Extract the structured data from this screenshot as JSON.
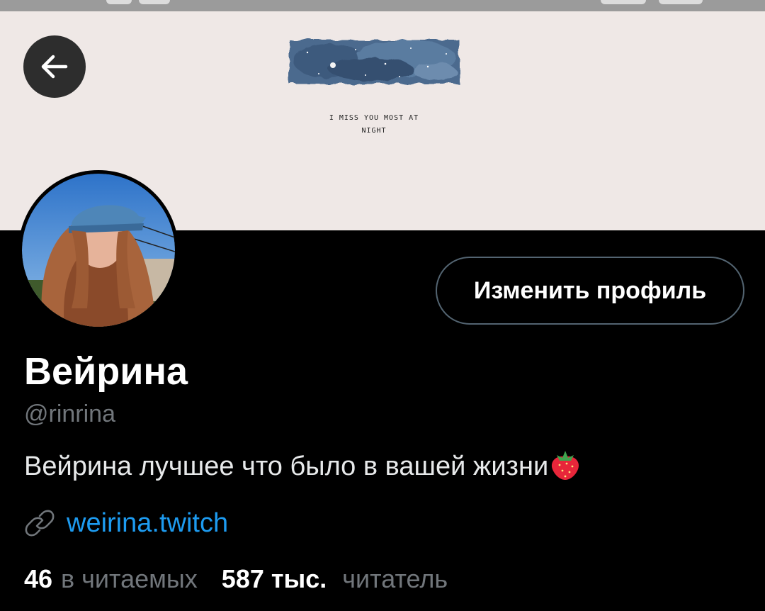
{
  "banner": {
    "caption_line1": "I MISS YOU MOST AT",
    "caption_line2": "NIGHT"
  },
  "header": {
    "back_icon": "arrow-left-icon"
  },
  "profile": {
    "avatar_icon": "avatar",
    "edit_button_label": "Изменить профиль",
    "display_name": "Вейрина",
    "handle": "@rinrina",
    "bio": "Вейрина лучшее что было в вашей жизни",
    "bio_emoji_icon": "strawberry-icon",
    "link_icon": "link-icon",
    "link_text": "weirina.twitch"
  },
  "stats": {
    "following_count": "46",
    "following_label": "в читаемых",
    "followers_count": "587 тыс.",
    "followers_label": "читатель"
  },
  "colors": {
    "background": "#000000",
    "banner": "#efe8e6",
    "link": "#1d9bf0",
    "muted": "#71767b",
    "button_border": "#536471"
  }
}
